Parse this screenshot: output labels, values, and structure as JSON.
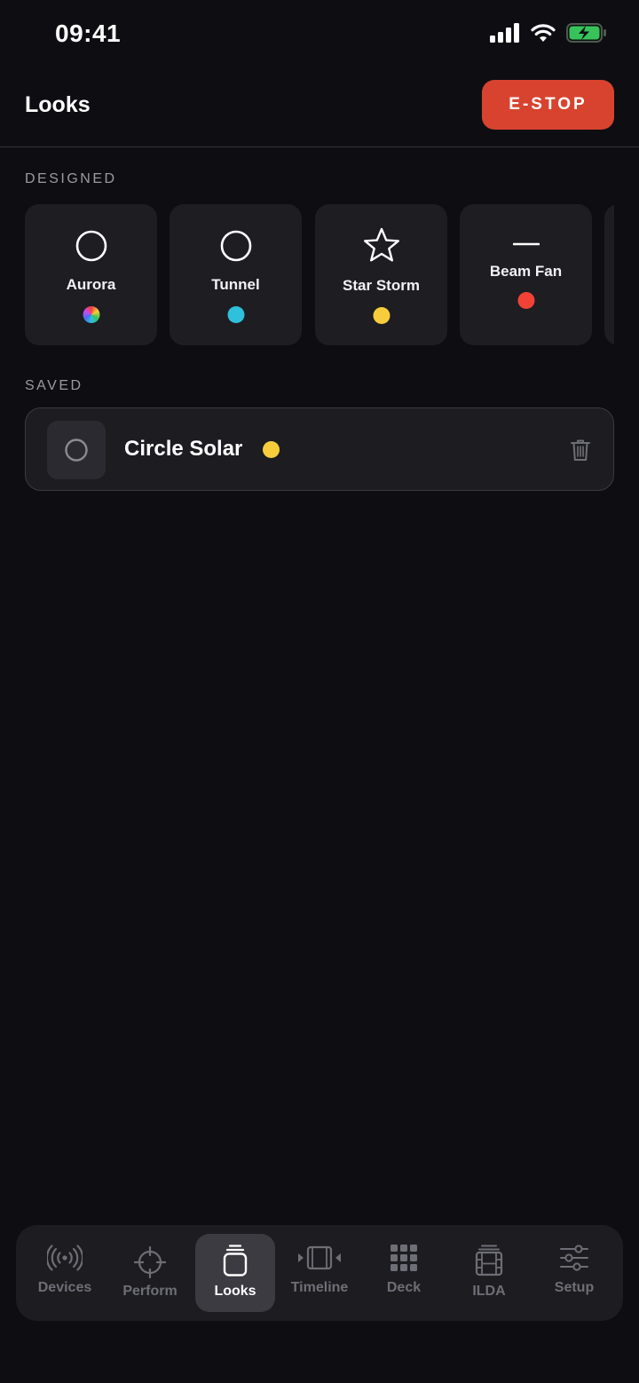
{
  "status": {
    "time": "09:41"
  },
  "header": {
    "title": "Looks",
    "estop_label": "E-STOP"
  },
  "designed": {
    "label": "DESIGNED",
    "items": [
      {
        "label": "Aurora",
        "icon": "circle-icon",
        "color": "rainbow"
      },
      {
        "label": "Tunnel",
        "icon": "circle-icon",
        "color": "#2ec0dc"
      },
      {
        "label": "Star Storm",
        "icon": "star-icon",
        "color": "#f7cd3c"
      },
      {
        "label": "Beam Fan",
        "icon": "line-icon",
        "color": "#f24236"
      }
    ]
  },
  "saved": {
    "label": "SAVED",
    "items": [
      {
        "name": "Circle Solar",
        "icon": "circle-icon",
        "color": "#f7cd3c"
      }
    ]
  },
  "tabs": [
    {
      "label": "Devices",
      "icon": "broadcast-icon",
      "active": false
    },
    {
      "label": "Perform",
      "icon": "crosshair-icon",
      "active": false
    },
    {
      "label": "Looks",
      "icon": "stack-icon",
      "active": true
    },
    {
      "label": "Timeline",
      "icon": "timeline-icon",
      "active": false
    },
    {
      "label": "Deck",
      "icon": "grid-icon",
      "active": false
    },
    {
      "label": "ILDA",
      "icon": "film-icon",
      "active": false
    },
    {
      "label": "Setup",
      "icon": "sliders-icon",
      "active": false
    }
  ],
  "colors": {
    "accent": "#d8432f",
    "background": "#0e0e12",
    "card": "#1d1d22"
  }
}
